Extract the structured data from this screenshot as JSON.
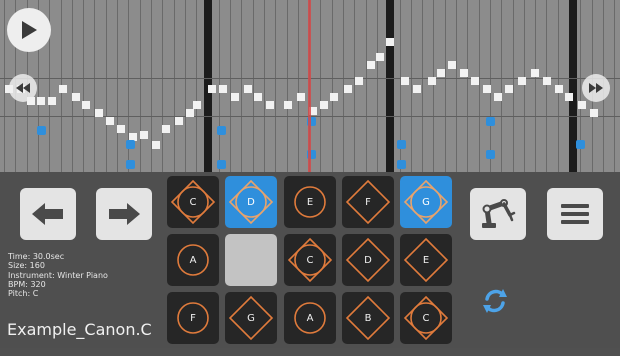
{
  "controls": {
    "play": "play-icon",
    "rewind": "rewind-icon",
    "fast_forward": "fast-forward-icon",
    "previous": "arrow-left-icon",
    "next": "arrow-right-icon",
    "record": "robot-arm-icon",
    "menu": "hamburger-menu-icon",
    "sync": "sync-icon"
  },
  "info": {
    "time": "Time: 30.0sec",
    "size": "Size: 160",
    "instrument": "Instrument: Winter Piano",
    "bpm": "BPM: 320",
    "pitch": "Pitch: C"
  },
  "song_title": "Example_Canon.C",
  "pads": [
    {
      "label": "C",
      "shape": "diamond-circle",
      "state": "normal"
    },
    {
      "label": "D",
      "shape": "diamond-circle",
      "state": "active-blue"
    },
    {
      "label": "E",
      "shape": "circle",
      "state": "normal"
    },
    {
      "label": "F",
      "shape": "diamond",
      "state": "normal"
    },
    {
      "label": "G",
      "shape": "diamond-circle",
      "state": "active-blue"
    },
    {
      "label": "A",
      "shape": "circle",
      "state": "normal"
    },
    {
      "label": "",
      "shape": "none",
      "state": "pressed-grey"
    },
    {
      "label": "C",
      "shape": "diamond-circle",
      "state": "normal"
    },
    {
      "label": "D",
      "shape": "diamond",
      "state": "normal"
    },
    {
      "label": "E",
      "shape": "diamond",
      "state": "normal"
    },
    {
      "label": "F",
      "shape": "circle",
      "state": "normal"
    },
    {
      "label": "G",
      "shape": "diamond",
      "state": "normal"
    },
    {
      "label": "A",
      "shape": "circle",
      "state": "normal"
    },
    {
      "label": "B",
      "shape": "diamond",
      "state": "normal"
    },
    {
      "label": "C",
      "shape": "diamond-circle",
      "state": "normal"
    }
  ],
  "colors": {
    "accent_blue": "#2f8fdc",
    "shape_orange": "#e07b3c",
    "playhead_red": "#d24a4a"
  }
}
